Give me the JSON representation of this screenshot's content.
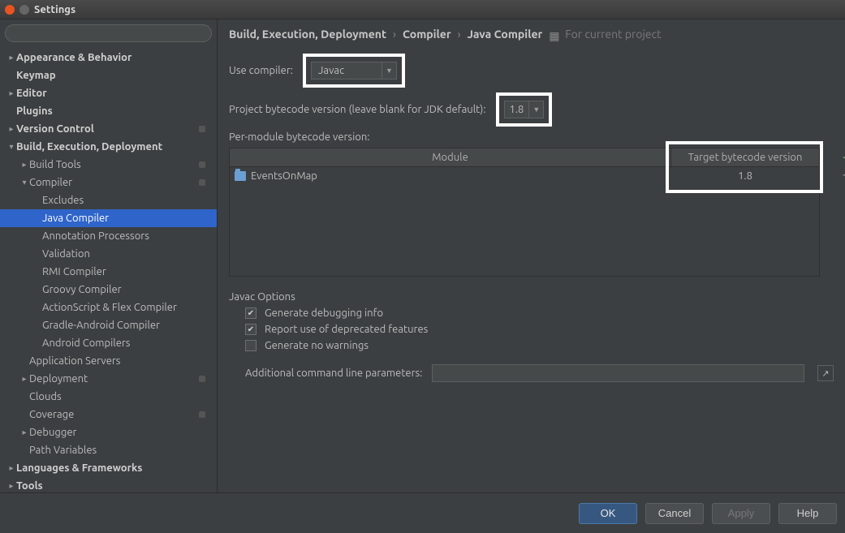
{
  "window_title": "Settings",
  "search_placeholder": "",
  "sidebar": [
    {
      "label": "Appearance & Behavior",
      "arrow": "▸",
      "ind": 0,
      "bold": true
    },
    {
      "label": "Keymap",
      "arrow": "",
      "ind": 0,
      "bold": true
    },
    {
      "label": "Editor",
      "arrow": "▸",
      "ind": 0,
      "bold": true
    },
    {
      "label": "Plugins",
      "arrow": "",
      "ind": 0,
      "bold": true
    },
    {
      "label": "Version Control",
      "arrow": "▸",
      "ind": 0,
      "bold": true,
      "dot": true
    },
    {
      "label": "Build, Execution, Deployment",
      "arrow": "▾",
      "ind": 0,
      "bold": true
    },
    {
      "label": "Build Tools",
      "arrow": "▸",
      "ind": 1,
      "dot": true
    },
    {
      "label": "Compiler",
      "arrow": "▾",
      "ind": 1,
      "dot": true
    },
    {
      "label": "Excludes",
      "arrow": "",
      "ind": 2
    },
    {
      "label": "Java Compiler",
      "arrow": "",
      "ind": 2,
      "selected": true
    },
    {
      "label": "Annotation Processors",
      "arrow": "",
      "ind": 2
    },
    {
      "label": "Validation",
      "arrow": "",
      "ind": 2
    },
    {
      "label": "RMI Compiler",
      "arrow": "",
      "ind": 2
    },
    {
      "label": "Groovy Compiler",
      "arrow": "",
      "ind": 2
    },
    {
      "label": "ActionScript & Flex Compiler",
      "arrow": "",
      "ind": 2
    },
    {
      "label": "Gradle-Android Compiler",
      "arrow": "",
      "ind": 2
    },
    {
      "label": "Android Compilers",
      "arrow": "",
      "ind": 2
    },
    {
      "label": "Application Servers",
      "arrow": "",
      "ind": 1
    },
    {
      "label": "Deployment",
      "arrow": "▸",
      "ind": 1,
      "dot": true
    },
    {
      "label": "Clouds",
      "arrow": "",
      "ind": 1
    },
    {
      "label": "Coverage",
      "arrow": "",
      "ind": 1,
      "dot": true
    },
    {
      "label": "Debugger",
      "arrow": "▸",
      "ind": 1
    },
    {
      "label": "Path Variables",
      "arrow": "",
      "ind": 1
    },
    {
      "label": "Languages & Frameworks",
      "arrow": "▸",
      "ind": 0,
      "bold": true
    },
    {
      "label": "Tools",
      "arrow": "▸",
      "ind": 0,
      "bold": true
    }
  ],
  "breadcrumb": {
    "c1": "Build, Execution, Deployment",
    "c2": "Compiler",
    "c3": "Java Compiler",
    "note": "For current project"
  },
  "labels": {
    "use_compiler": "Use compiler:",
    "project_bytecode": "Project bytecode version (leave blank for JDK default):",
    "per_module": "Per-module bytecode version:",
    "javac_options": "Javac Options",
    "generate_debugging": "Generate debugging info",
    "report_deprecated": "Report use of deprecated features",
    "generate_no_warnings": "Generate no warnings",
    "additional_params": "Additional command line parameters:"
  },
  "values": {
    "compiler": "Javac",
    "project_bytecode_version": "1.8"
  },
  "module_table": {
    "col_module": "Module",
    "col_target": "Target bytecode version",
    "row": {
      "name": "EventsOnMap",
      "target": "1.8"
    }
  },
  "checkboxes": {
    "generate_debugging": true,
    "report_deprecated": true,
    "generate_no_warnings": false
  },
  "additional_params_value": "",
  "buttons": {
    "ok": "OK",
    "cancel": "Cancel",
    "apply": "Apply",
    "help": "Help"
  }
}
